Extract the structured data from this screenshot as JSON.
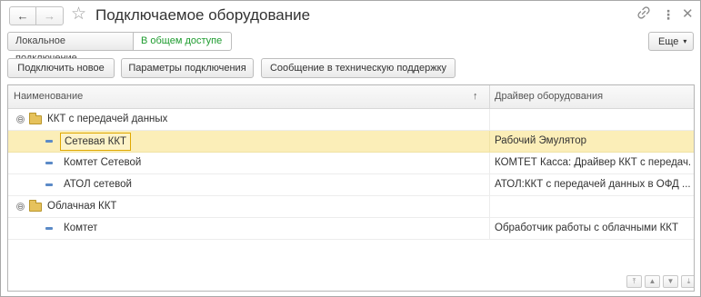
{
  "window": {
    "title": "Подключаемое оборудование"
  },
  "nav": {
    "back": "←",
    "forward": "→",
    "star": "☆"
  },
  "titlebar_icons": {
    "link": "🔗",
    "more": "⋮",
    "close": "✕"
  },
  "tabs": [
    {
      "label": "Локальное подключение",
      "active": false
    },
    {
      "label": "В общем доступе",
      "active": true
    }
  ],
  "more_button": {
    "label": "Еще",
    "caret": "▾"
  },
  "commands": [
    {
      "label": "Подключить новое"
    },
    {
      "label": "Параметры подключения"
    },
    {
      "label": "Сообщение в техническую поддержку"
    }
  ],
  "table": {
    "columns": {
      "name": "Наименование",
      "driver": "Драйвер оборудования",
      "sort_indicator": "↑"
    },
    "groups": [
      {
        "label": "ККТ с передачей данных",
        "expander": "⊖",
        "items": [
          {
            "name": "Сетевая ККТ",
            "driver": "Рабочий Эмулятор",
            "selected": true
          },
          {
            "name": "Комтет Сетевой",
            "driver": "КОМТЕТ Касса: Драйвер ККТ с передач...",
            "selected": false
          },
          {
            "name": "АТОЛ сетевой",
            "driver": "АТОЛ:ККТ с передачей данных в ОФД ...",
            "selected": false
          }
        ]
      },
      {
        "label": "Облачная ККТ",
        "expander": "⊖",
        "items": [
          {
            "name": "Комтет",
            "driver": "Обработчик работы с облачными ККТ",
            "selected": false
          }
        ]
      }
    ]
  },
  "scroll_buttons": [
    "⤒",
    "▲",
    "▼",
    "⤓"
  ],
  "colors": {
    "active_tab_text": "#1e9c2f",
    "selection": "#fbeeb8",
    "focus_border": "#e0a800"
  }
}
